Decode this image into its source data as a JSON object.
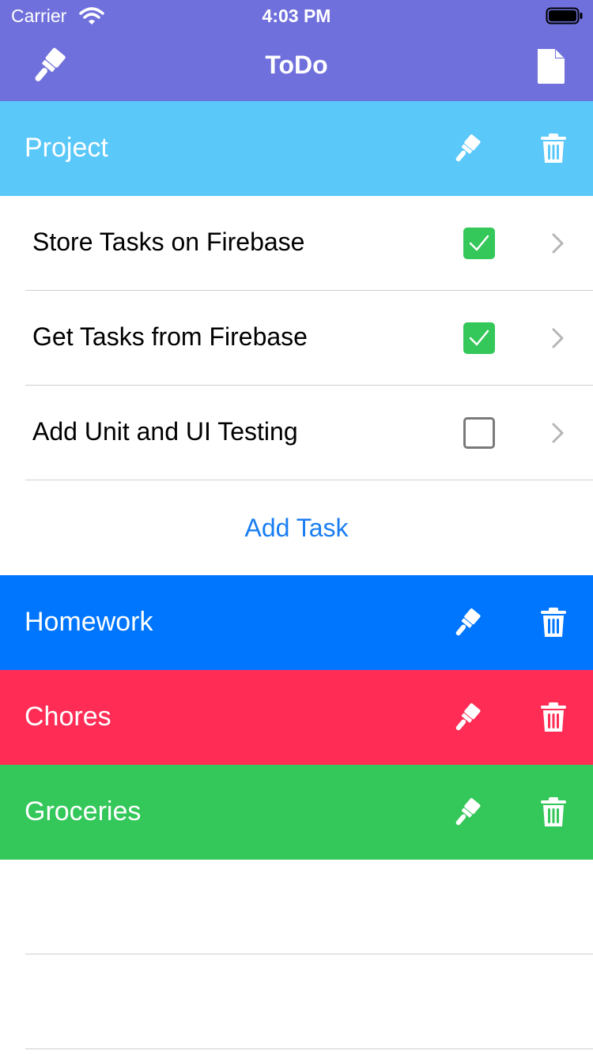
{
  "status_bar": {
    "carrier": "Carrier",
    "time": "4:03 PM"
  },
  "nav": {
    "title": "ToDo",
    "left_icon": "paintbrush-icon",
    "right_icon": "document-icon",
    "background": "#7070DC"
  },
  "sections": [
    {
      "title": "Project",
      "color": "#5BC8FA",
      "expanded": true,
      "tasks": [
        {
          "label": "Store Tasks on Firebase",
          "done": true
        },
        {
          "label": "Get Tasks from Firebase",
          "done": true
        },
        {
          "label": "Add Unit and UI Testing",
          "done": false
        }
      ],
      "add_task_label": "Add Task"
    },
    {
      "title": "Homework",
      "color": "#0076FF",
      "expanded": false
    },
    {
      "title": "Chores",
      "color": "#FF2D55",
      "expanded": false
    },
    {
      "title": "Groceries",
      "color": "#34C759",
      "expanded": false
    }
  ],
  "colors": {
    "accent": "#1A7EF2",
    "checked": "#34C759"
  }
}
